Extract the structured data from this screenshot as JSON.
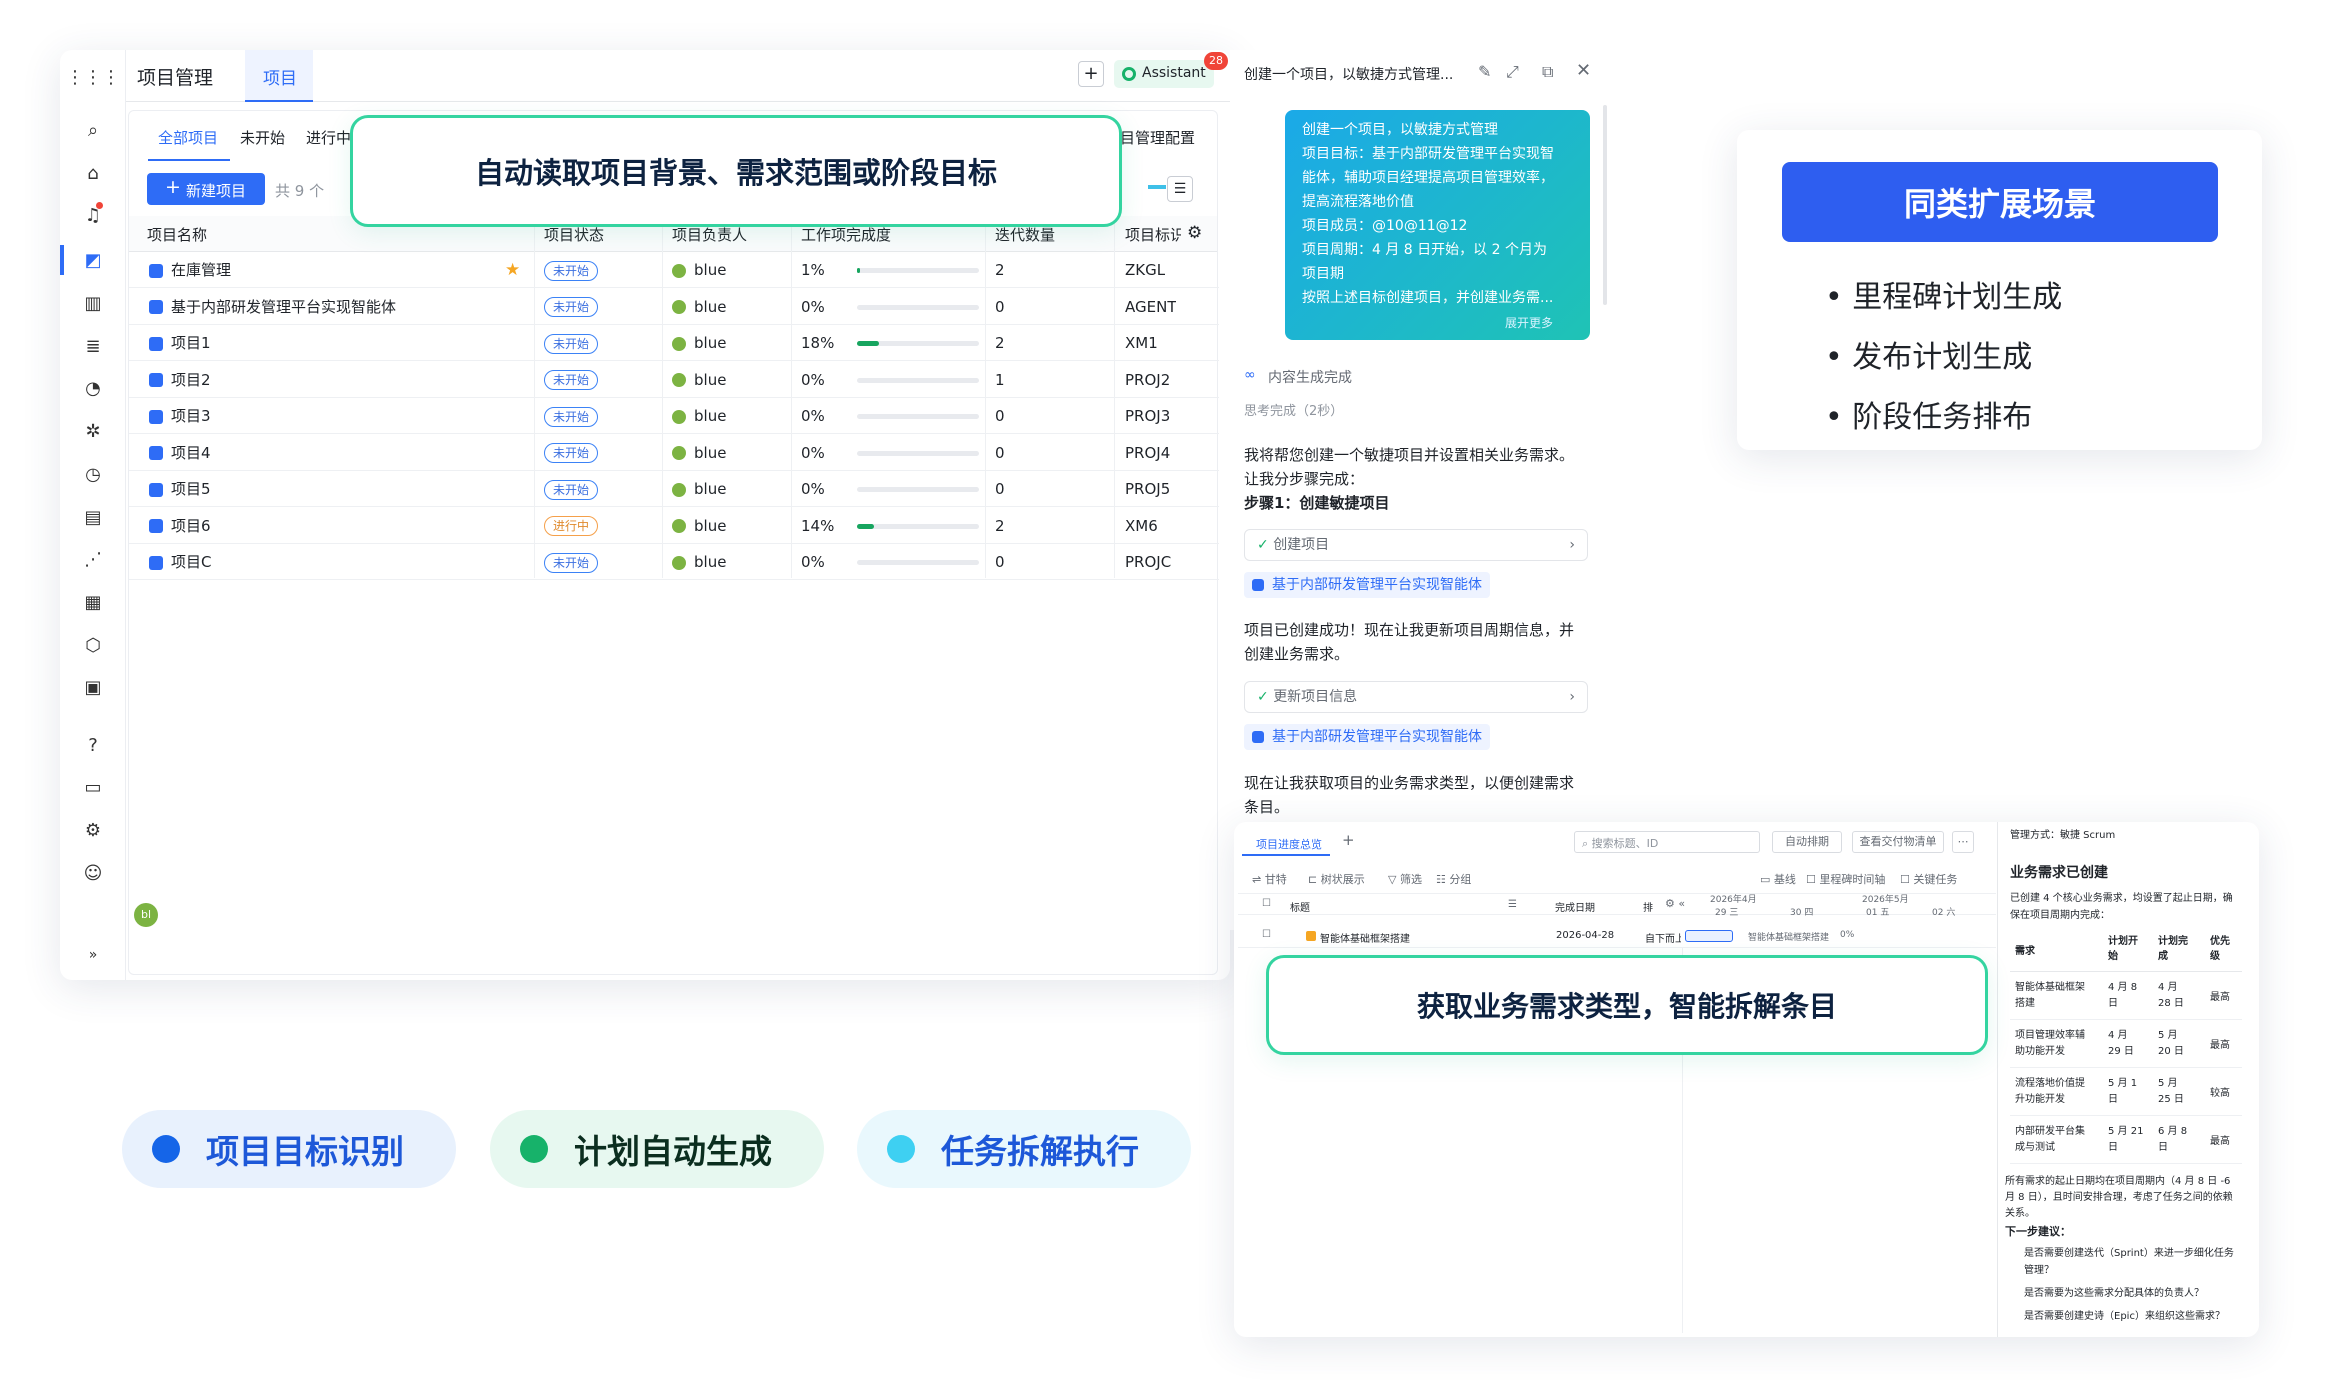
{
  "app": {
    "title": "项目管理",
    "tab": "项目",
    "assistant_label": "Assistant",
    "assistant_badge": "28",
    "sub_tabs": [
      "全部项目",
      "未开始",
      "进行中"
    ],
    "config_link": "目管理配置",
    "new_button": "新建项目",
    "count": "共 9 个",
    "columns": [
      "项目名称",
      "项目状态",
      "项目负责人",
      "工作项完成度",
      "迭代数量",
      "项目标识"
    ],
    "rows": [
      {
        "name": "在庫管理",
        "status": "未开始",
        "owner": "blue",
        "progress": "1%",
        "pct": 0.01,
        "iters": "2",
        "key": "ZKGL",
        "star": true
      },
      {
        "name": "基于内部研发管理平台实现智能体",
        "status": "未开始",
        "owner": "blue",
        "progress": "0%",
        "pct": 0,
        "iters": "0",
        "key": "AGENT"
      },
      {
        "name": "项目1",
        "status": "未开始",
        "owner": "blue",
        "progress": "18%",
        "pct": 0.18,
        "iters": "2",
        "key": "XM1"
      },
      {
        "name": "项目2",
        "status": "未开始",
        "owner": "blue",
        "progress": "0%",
        "pct": 0,
        "iters": "1",
        "key": "PROJ2"
      },
      {
        "name": "项目3",
        "status": "未开始",
        "owner": "blue",
        "progress": "0%",
        "pct": 0,
        "iters": "0",
        "key": "PROJ3"
      },
      {
        "name": "项目4",
        "status": "未开始",
        "owner": "blue",
        "progress": "0%",
        "pct": 0,
        "iters": "0",
        "key": "PROJ4"
      },
      {
        "name": "项目5",
        "status": "未开始",
        "owner": "blue",
        "progress": "0%",
        "pct": 0,
        "iters": "0",
        "key": "PROJ5"
      },
      {
        "name": "项目6",
        "status": "进行中",
        "owner": "blue",
        "progress": "14%",
        "pct": 0.14,
        "iters": "2",
        "key": "XM6"
      },
      {
        "name": "项目C",
        "status": "未开始",
        "owner": "blue",
        "progress": "0%",
        "pct": 0,
        "iters": "0",
        "key": "PROJC"
      }
    ],
    "avatar_initials": "bl"
  },
  "callouts": {
    "top": "自动读取项目背景、需求范围或阶段目标",
    "bottom": "获取业务需求类型，智能拆解条目"
  },
  "chat": {
    "title": "创建一个项目，以敏捷方式管理...",
    "user_msg": [
      "创建一个项目，以敏捷方式管理",
      "项目目标：基于内部研发管理平台实现智",
      "能体，辅助项目经理提高项目管理效率，",
      "提高流程落地价值",
      "项目成员：@10@11@12",
      "项目周期：4 月 8 日开始，以 2 个月为",
      "项目期",
      "按照上述目标创建项目，并创建业务需..."
    ],
    "expand": "展开更多",
    "status": "内容生成完成",
    "thinking": "思考完成（2秒）",
    "reply1": [
      "我将帮您创建一个敏捷项目并设置相关业务需求。",
      "让我分步骤完成："
    ],
    "step1": "步骤1：创建敏捷项目",
    "action1": "创建项目",
    "link1": "基于内部研发管理平台实现智能体",
    "reply2": [
      "项目已创建成功！现在让我更新项目周期信息，并",
      "创建业务需求。"
    ],
    "action2": "更新项目信息",
    "link2": "基于内部研发管理平台实现智能体",
    "reply3": [
      "现在让我获取项目的业务需求类型，以便创建需求",
      "条目。"
    ]
  },
  "ext": {
    "title": "同类扩展场景",
    "items": [
      "里程碑计划生成",
      "发布计划生成",
      "阶段任务排布"
    ]
  },
  "pills": [
    {
      "label": "项目目标识别",
      "color": "#1565e8",
      "bg": "#e8f1fd"
    },
    {
      "label": "计划自动生成",
      "color": "#17b26a",
      "bg": "#e7f8f0"
    },
    {
      "label": "任务拆解执行",
      "color": "#3ed0f2",
      "bg": "#e9f8fd"
    }
  ],
  "sub": {
    "tab": "项目进度总览",
    "search": "搜索标题、ID",
    "btn1": "自动排期",
    "btn2": "查看交付物清单",
    "tools": [
      "甘特",
      "树状展示",
      "筛选",
      "分组"
    ],
    "legend": [
      "基线",
      "里程碑时间轴",
      "关键任务"
    ],
    "col_title": "标题",
    "col_date": "完成日期",
    "col_pri": "排",
    "month1": "2026年4月",
    "month2": "2026年5月",
    "days": [
      "29 三",
      "30 四",
      "01 五",
      "02 六"
    ],
    "task": "智能体基础框架搭建",
    "task_date": "2026-04-28",
    "task_owner": "自下而上",
    "task_bar": "智能体基础框架搭建",
    "task_pct": "0%",
    "right": {
      "method": "管理方式：敏捷 Scrum",
      "heading": "业务需求已创建",
      "intro": [
        "已创建 4 个核心业务需求，均设置了起止日期，确",
        "保在项目周期内完成："
      ],
      "cols": [
        "需求",
        "计划开始",
        "计划完成",
        "优先级"
      ],
      "rows": [
        {
          "name": [
            "智能体基础框架",
            "搭建"
          ],
          "start": [
            "4 月 8",
            "日"
          ],
          "end": [
            "4 月",
            "28 日"
          ],
          "pri": "最高"
        },
        {
          "name": [
            "项目管理效率辅",
            "助功能开发"
          ],
          "start": [
            "4 月",
            "29 日"
          ],
          "end": [
            "5 月",
            "20 日"
          ],
          "pri": "最高"
        },
        {
          "name": [
            "流程落地价值提",
            "升功能开发"
          ],
          "start": [
            "5 月 1",
            "日"
          ],
          "end": [
            "5 月",
            "25 日"
          ],
          "pri": "较高"
        },
        {
          "name": [
            "内部研发平台集",
            "成与测试"
          ],
          "start": [
            "5 月 21",
            "日"
          ],
          "end": [
            "6 月 8",
            "日"
          ],
          "pri": "最高"
        }
      ],
      "footer": [
        "所有需求的起止日期均在项目周期内（4 月 8 日 -6",
        "月 8 日），且时间安排合理，考虑了任务之间的依赖",
        "关系。"
      ],
      "next_title": "下一步建议：",
      "next": [
        "是否需要创建迭代（Sprint）来进一步细化任务",
        "管理？",
        "是否需要为这些需求分配具体的负责人？",
        "是否需要创建史诗（Epic）来组织这些需求？"
      ]
    }
  }
}
